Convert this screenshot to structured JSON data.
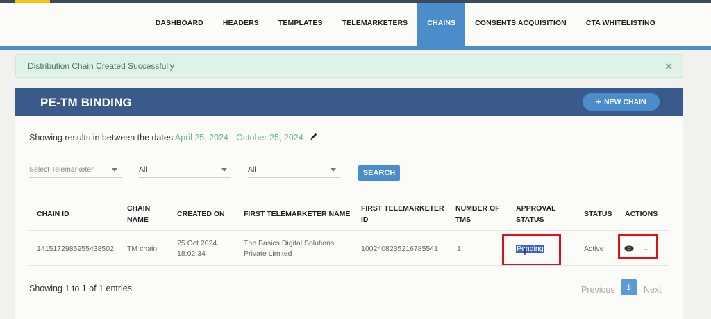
{
  "nav": {
    "items": [
      {
        "label": "DASHBOARD"
      },
      {
        "label": "HEADERS"
      },
      {
        "label": "TEMPLATES"
      },
      {
        "label": "TELEMARKETERS"
      },
      {
        "label": "CHAINS",
        "active": true
      },
      {
        "label": "CONSENTS ACQUISITION"
      },
      {
        "label": "CTA WHITELISTING"
      }
    ]
  },
  "alert": {
    "message": "Distribution Chain Created Successfully",
    "close_glyph": "×"
  },
  "card": {
    "title": "PE-TM BINDING",
    "new_chain_label": "NEW CHAIN"
  },
  "date_filter": {
    "prefix": "Showing results in between the dates ",
    "range": "April 25, 2024 - October 25, 2024"
  },
  "filters": {
    "telemarketer": "Select Telemarketer",
    "filter2": "All",
    "filter3": "All",
    "search_label": "SEARCH"
  },
  "table": {
    "headers": {
      "chain_id": "CHAIN ID",
      "chain_name_1": "CHAIN",
      "chain_name_2": "NAME",
      "created_on": "CREATED ON",
      "first_tm_name": "FIRST TELEMARKETER NAME",
      "first_tm_id_1": "FIRST TELEMARKETER",
      "first_tm_id_2": "ID",
      "num_tms_1": "NUMBER OF",
      "num_tms_2": "TMS",
      "approval_1": "APPROVAL",
      "approval_2": "STATUS",
      "status": "STATUS",
      "actions": "ACTIONS"
    },
    "rows": [
      {
        "chain_id": "1415172985955438502",
        "chain_name": "TM chain",
        "created_date": "25 Oct 2024",
        "created_time": "18:02:34",
        "first_tm_name_1": "The Basics Digital Solutions",
        "first_tm_name_2": "Private Limited",
        "first_tm_id": "1002408235216785541",
        "num_tms": "1",
        "approval_status": "Pending",
        "status": "Active",
        "action_dash": "–"
      }
    ]
  },
  "footer": {
    "entries": "Showing 1 to 1 of 1 entries",
    "previous": "Previous",
    "page": "1",
    "next": "Next"
  },
  "colors": {
    "accent": "#4a8dcb",
    "header_bg": "#3a5a8c",
    "success_bg": "#def2e7",
    "highlight": "#e0101a"
  }
}
